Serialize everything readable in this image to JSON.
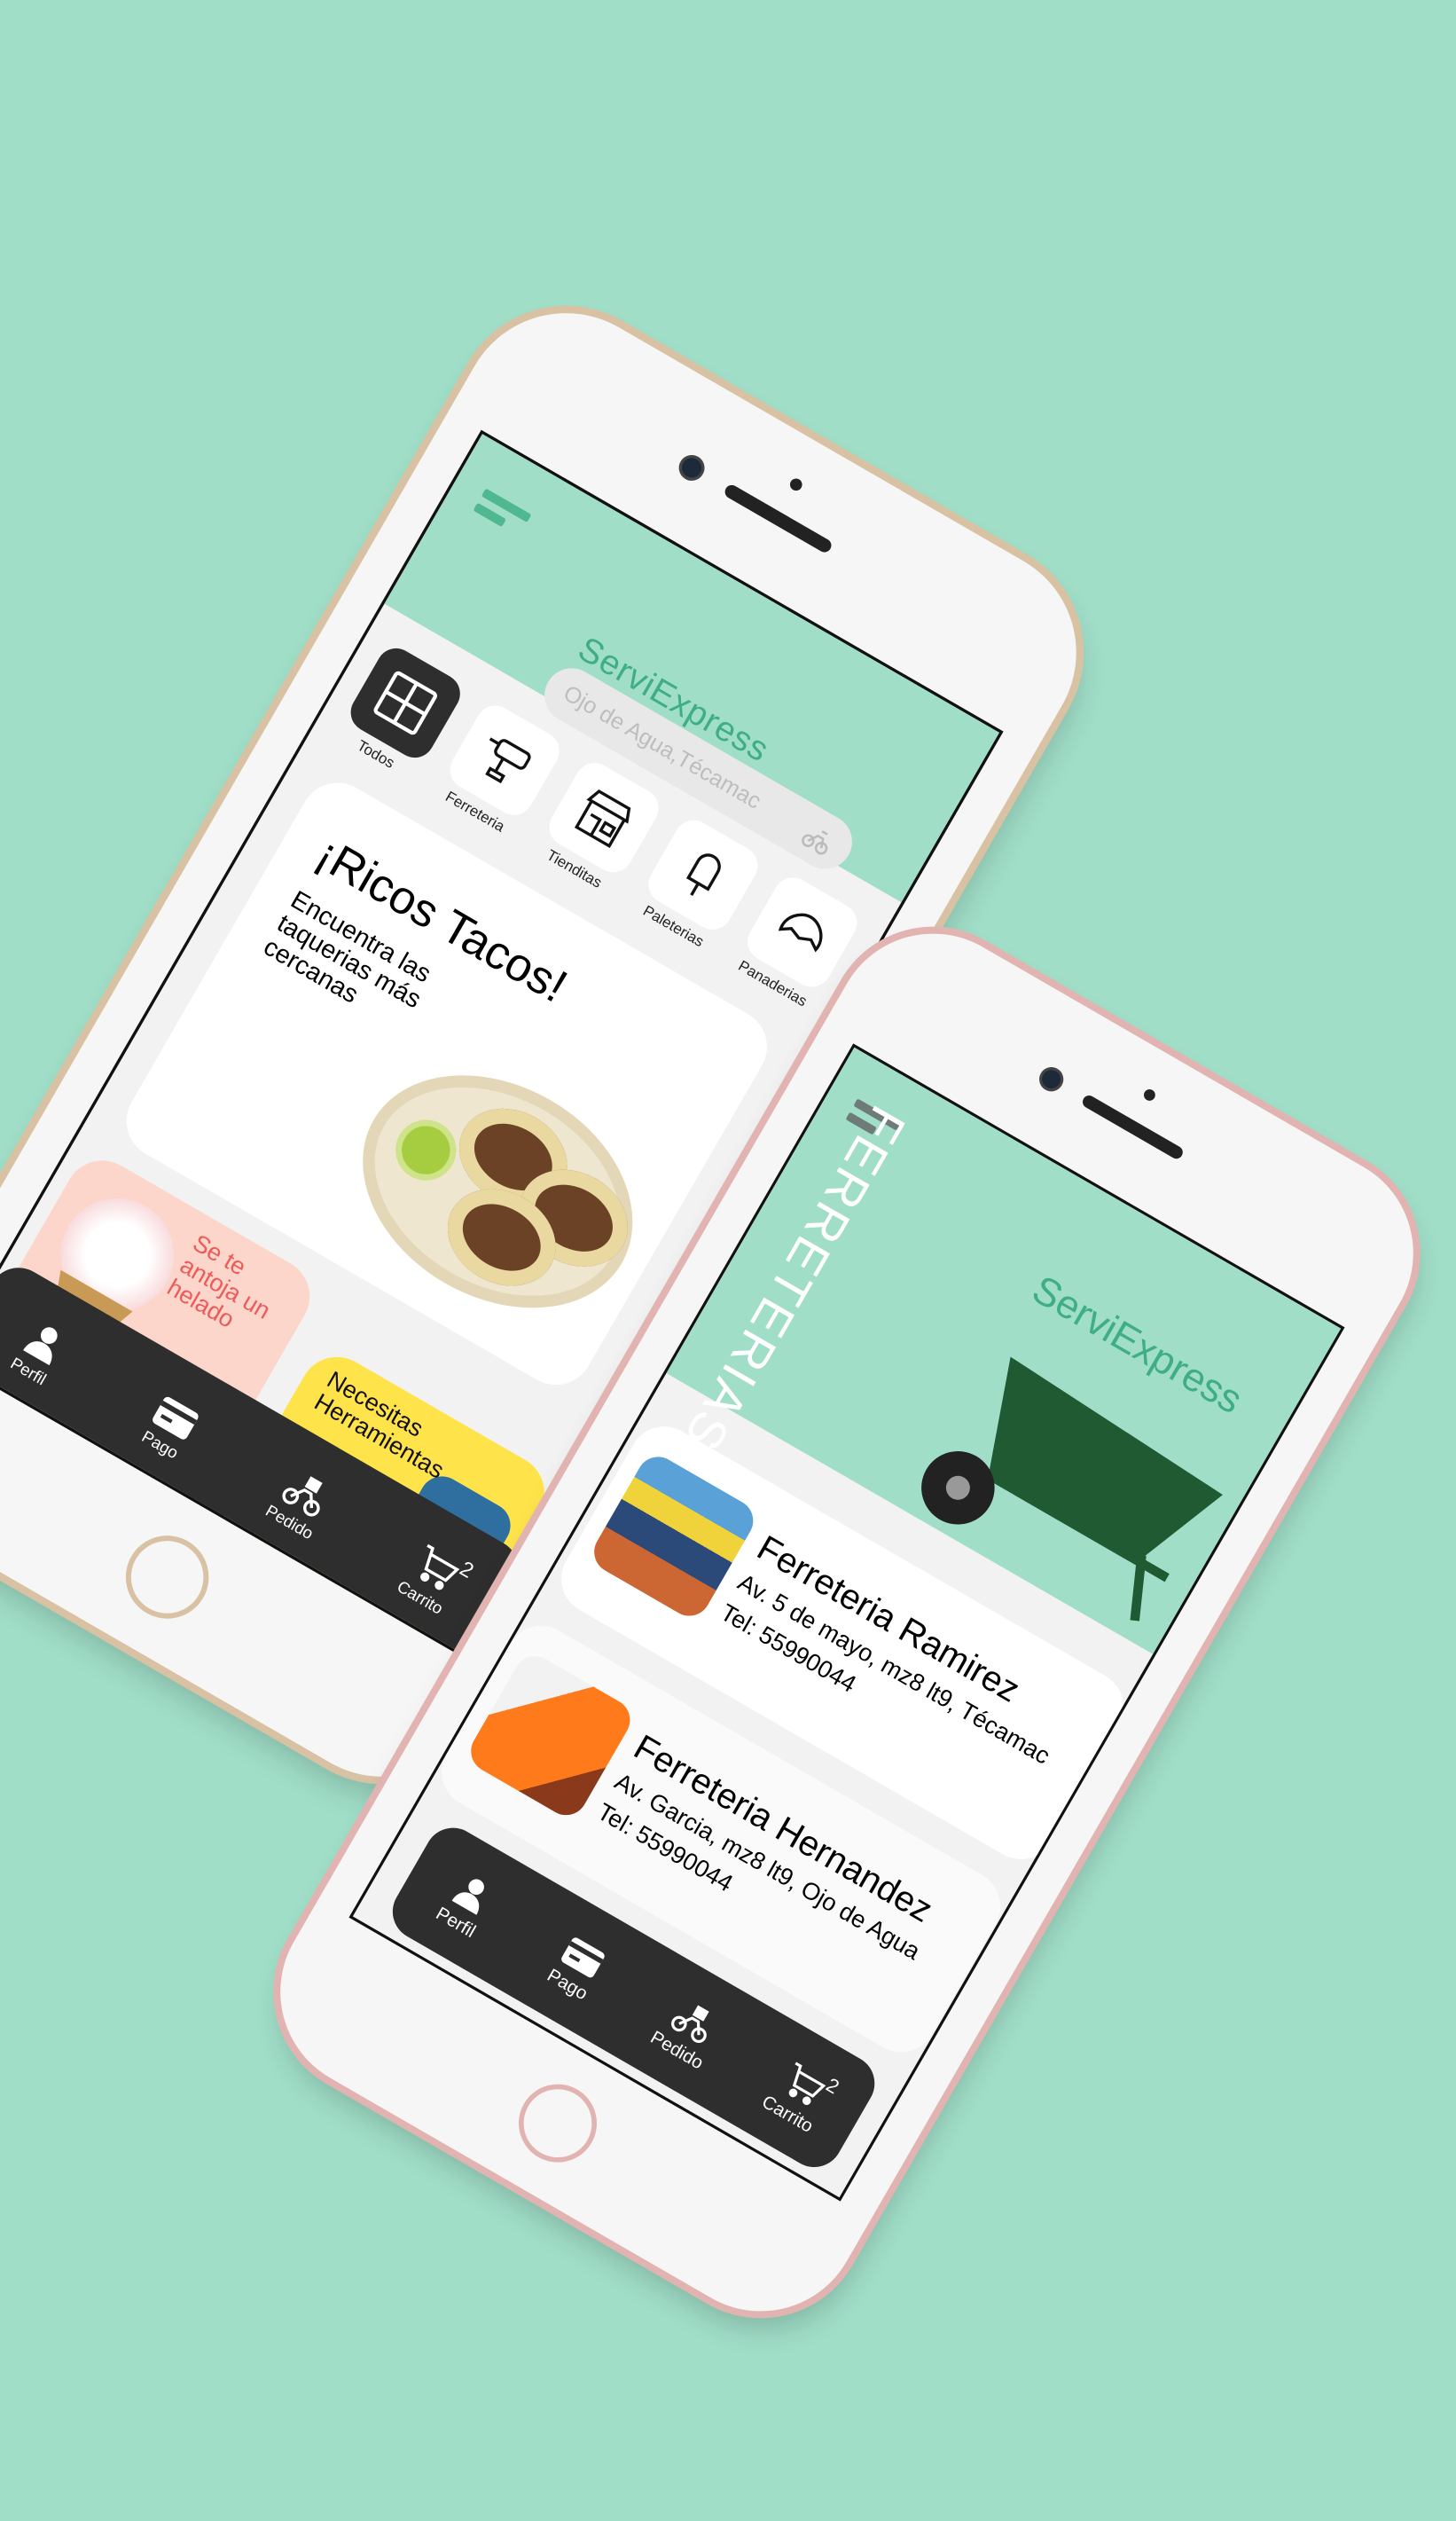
{
  "app": {
    "title": "ServiExpress",
    "bg_color": "#a0dec8",
    "accent": "#3fae85"
  },
  "home": {
    "search_placeholder": "Ojo de Agua,Técamac",
    "categories": [
      {
        "label": "Todos",
        "icon": "grid-icon"
      },
      {
        "label": "Ferreteria",
        "icon": "drill-icon"
      },
      {
        "label": "Tienditas",
        "icon": "store-icon"
      },
      {
        "label": "Paleterias",
        "icon": "popsicle-icon"
      },
      {
        "label": "Panaderias",
        "icon": "croissant-icon"
      }
    ],
    "hero": {
      "title": "¡Ricos Tacos!",
      "subtitle": "Encuentra las taquerias más cercanas"
    },
    "promos": [
      {
        "text": "Se te antoja un helado"
      },
      {
        "text": "Necesitas Herramientas"
      }
    ]
  },
  "nav": {
    "items": [
      {
        "label": "Perfil"
      },
      {
        "label": "Pago"
      },
      {
        "label": "Pedido"
      },
      {
        "label": "Carrito"
      }
    ],
    "cart_count": "2"
  },
  "ferreterias": {
    "heading": "FERRETERIAS",
    "stores": [
      {
        "name": "Ferreteria Ramirez",
        "address": "Av. 5 de mayo, mz8 lt9, Técamac",
        "tel": "Tel: 55990044"
      },
      {
        "name": "Ferreteria Hernandez",
        "address": "Av. Garcia, mz8 lt9, Ojo de Agua",
        "tel": "Tel: 55990044"
      }
    ]
  }
}
